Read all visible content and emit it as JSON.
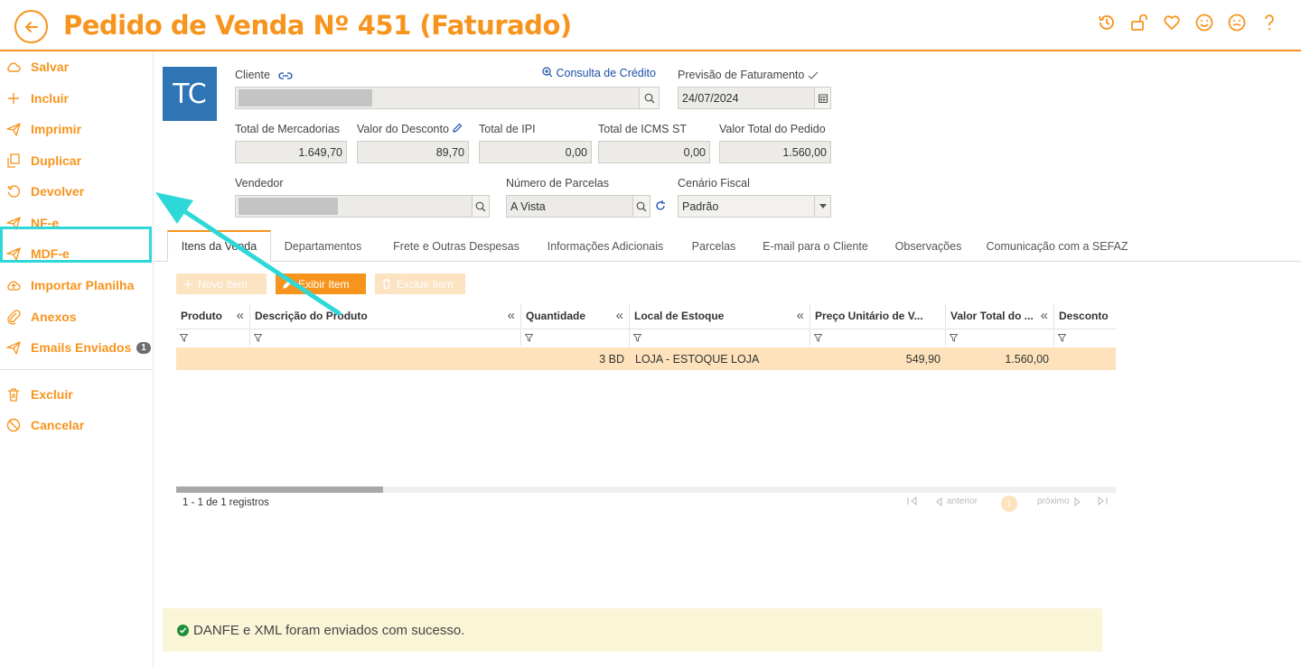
{
  "header": {
    "title": "Pedido de Venda Nº 451 (Faturado)",
    "icons": [
      "history-icon",
      "unlock-icon",
      "heart-icon",
      "smile-icon",
      "neutral-face-icon",
      "help-icon"
    ],
    "accent_color": "#f7941d"
  },
  "sidebar": {
    "items": [
      {
        "label": "Salvar",
        "icon": "cloud-icon"
      },
      {
        "label": "Incluir",
        "icon": "plus-icon"
      },
      {
        "label": "Imprimir",
        "icon": "send-icon"
      },
      {
        "label": "Duplicar",
        "icon": "copy-icon"
      },
      {
        "label": "Devolver",
        "icon": "undo-icon"
      },
      {
        "label": "NF-e",
        "icon": "send-icon"
      },
      {
        "label": "MDF-e",
        "icon": "send-icon"
      },
      {
        "label": "Importar Planilha",
        "icon": "upload-cloud-icon"
      },
      {
        "label": "Anexos",
        "icon": "paperclip-icon"
      },
      {
        "label": "Emails Enviados",
        "icon": "send-icon",
        "badge": "1"
      },
      {
        "label": "Excluir",
        "icon": "trash-icon"
      },
      {
        "label": "Cancelar",
        "icon": "block-icon"
      }
    ]
  },
  "form": {
    "avatar_initials": "TC",
    "cliente_label": "Cliente",
    "consulta_credito": "Consulta de Crédito",
    "previsao_label": "Previsão de Faturamento",
    "previsao_value": "24/07/2024",
    "total_mercadorias_label": "Total de Mercadorias",
    "total_mercadorias_value": "1.649,70",
    "valor_desconto_label": "Valor do Desconto",
    "valor_desconto_value": "89,70",
    "total_ipi_label": "Total de IPI",
    "total_ipi_value": "0,00",
    "total_icms_st_label": "Total de ICMS ST",
    "total_icms_st_value": "0,00",
    "valor_total_label": "Valor Total do Pedido",
    "valor_total_value": "1.560,00",
    "vendedor_label": "Vendedor",
    "parcelas_label": "Número de Parcelas",
    "parcelas_value": "A Vista",
    "cenario_label": "Cenário Fiscal",
    "cenario_value": "Padrão"
  },
  "tabs": [
    "Itens da Venda",
    "Departamentos",
    "Frete e Outras Despesas",
    "Informações Adicionais",
    "Parcelas",
    "E-mail para o Cliente",
    "Observações",
    "Comunicação com a SEFAZ"
  ],
  "actions": {
    "novo_item": "Novo Item",
    "exibir_item": "Exibir Item",
    "excluir_item": "Excluir Item"
  },
  "grid": {
    "columns": [
      "Produto",
      "Descrição do Produto",
      "Quantidade",
      "Local de Estoque",
      "Preço Unitário de V...",
      "Valor Total do ...",
      "Desconto"
    ],
    "collapse_glyph": "«",
    "rows": [
      {
        "produto": "",
        "descricao": "",
        "quantidade": "3 BD",
        "local": "LOJA - ESTOQUE LOJA",
        "preco": "549,90",
        "valor_total": "1.560,00",
        "desconto": ""
      }
    ],
    "records_text": "1 - 1 de 1 registros",
    "pager": {
      "anterior": "anterior",
      "proximo": "próximo",
      "page": "1"
    }
  },
  "message": {
    "text": "DANFE e XML foram enviados com sucesso."
  }
}
